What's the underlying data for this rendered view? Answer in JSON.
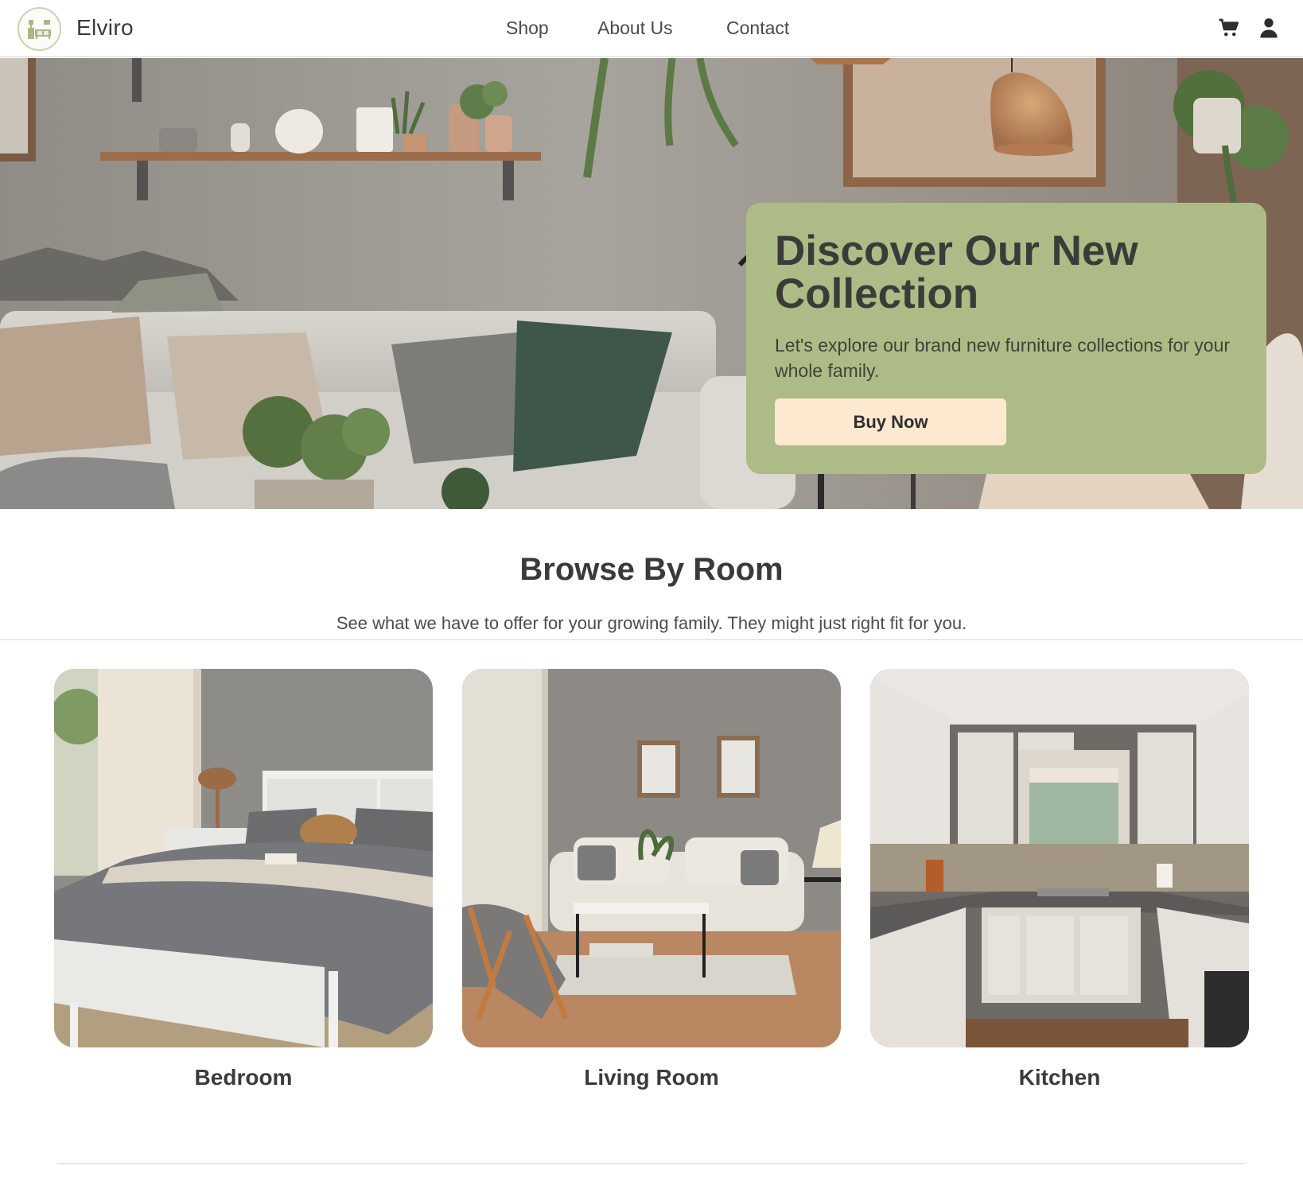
{
  "header": {
    "brand": "Elviro",
    "logo_icon": "furniture-logo-icon",
    "nav": [
      {
        "label": "Shop"
      },
      {
        "label": "About Us"
      },
      {
        "label": "Contact"
      }
    ],
    "icons": [
      "cart-icon",
      "user-icon"
    ]
  },
  "hero": {
    "title": "Discover Our New Collection",
    "subtitle": "Let's explore our brand new furniture collections for your whole family.",
    "button_label": "Buy Now",
    "image": "living-room-hero-photo"
  },
  "browse": {
    "title": "Browse By Room",
    "subtitle": "See what we have to offer for your growing family. They might just right fit for you.",
    "rooms": [
      {
        "label": "Bedroom",
        "image": "bedroom-photo"
      },
      {
        "label": "Living Room",
        "image": "living-room-photo"
      },
      {
        "label": "Kitchen",
        "image": "kitchen-photo"
      }
    ]
  },
  "colors": {
    "accent_green": "#adbc86",
    "button_cream": "#fde8d0",
    "text_dark": "#3a3a3a"
  }
}
